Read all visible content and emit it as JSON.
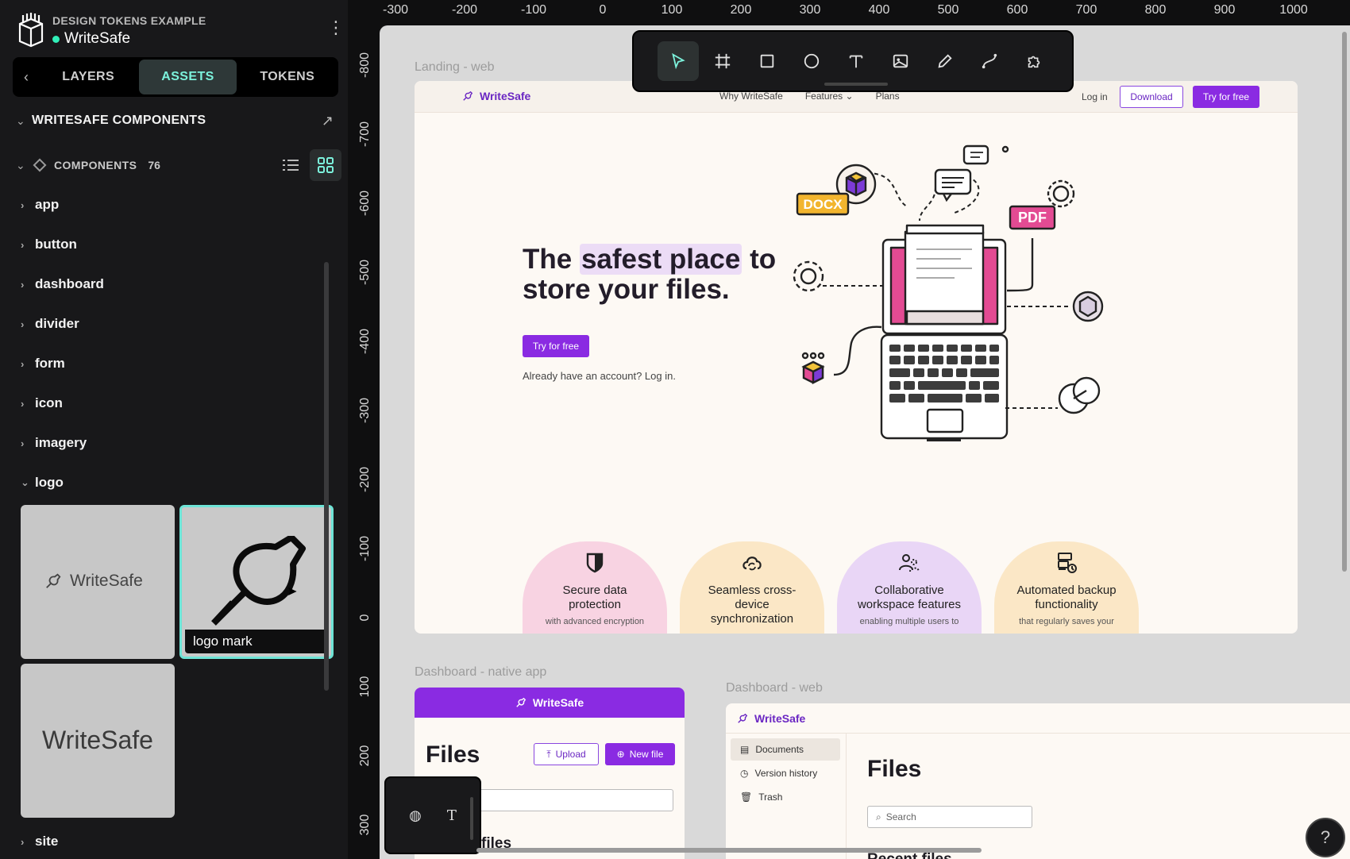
{
  "project": {
    "subtitle": "DESIGN TOKENS EXAMPLE",
    "name": "WriteSafe",
    "status_color": "#31efb8"
  },
  "tabs": [
    {
      "label": "LAYERS"
    },
    {
      "label": "ASSETS"
    },
    {
      "label": "TOKENS"
    }
  ],
  "library": {
    "title": "WRITESAFE COMPONENTS"
  },
  "components": {
    "label": "COMPONENTS",
    "count": "76"
  },
  "groups": [
    "app",
    "button",
    "dashboard",
    "divider",
    "form",
    "icon",
    "imagery",
    "logo",
    "site"
  ],
  "logo_thumbs": {
    "wordmark_small": "WriteSafe",
    "selected_caption": "logo mark",
    "wordmark_large": "WriteSafe"
  },
  "ruler_top": [
    "-300",
    "-200",
    "-100",
    "0",
    "100",
    "200",
    "300",
    "400",
    "500",
    "600",
    "700",
    "800",
    "900",
    "1000"
  ],
  "ruler_left": [
    "-800",
    "-700",
    "-600",
    "-500",
    "-400",
    "-300",
    "-200",
    "-100",
    "0",
    "100",
    "200",
    "300"
  ],
  "toolbar_tools": [
    "pointer-tool",
    "frame-tool",
    "rectangle-tool",
    "ellipse-tool",
    "text-tool",
    "image-tool",
    "pencil-tool",
    "path-tool",
    "plugins-tool"
  ],
  "frames": {
    "landing_label": "Landing - web",
    "dash_native_label": "Dashboard - native app",
    "dash_web_label": "Dashboard - web"
  },
  "landing": {
    "brand": "WriteSafe",
    "nav_links": [
      "Why WriteSafe",
      "Features",
      "Plans"
    ],
    "login": "Log in",
    "download": "Download",
    "try": "Try for free",
    "hero_pre": "The ",
    "hero_hl": "safest place",
    "hero_post": " to store your files.",
    "hero_btn": "Try for free",
    "hero_note": "Already have an account? Log in.",
    "docx": "DOCX",
    "pdf": "PDF",
    "features": [
      {
        "title": "Secure data protection",
        "sub": "with advanced encryption",
        "color": "#f8d3e2"
      },
      {
        "title": "Seamless cross-device synchronization",
        "sub": "",
        "color": "#fbe7c6"
      },
      {
        "title": "Collaborative workspace features",
        "sub": "enabling multiple users to",
        "color": "#e9d6f6"
      },
      {
        "title": "Automated backup functionality",
        "sub": "that regularly saves your",
        "color": "#fbe7c6"
      }
    ]
  },
  "dash_native": {
    "brand": "WriteSafe",
    "title": "Files",
    "upload": "Upload",
    "new_file": "New file",
    "files": "files"
  },
  "dash_web": {
    "brand": "WriteSafe",
    "nav": [
      "Documents",
      "Version history",
      "Trash"
    ],
    "title": "Files",
    "search_placeholder": "Search",
    "recent": "Recent files"
  },
  "colors": {
    "accent": "#7cf2dc",
    "brand_purple": "#8a2be2"
  }
}
